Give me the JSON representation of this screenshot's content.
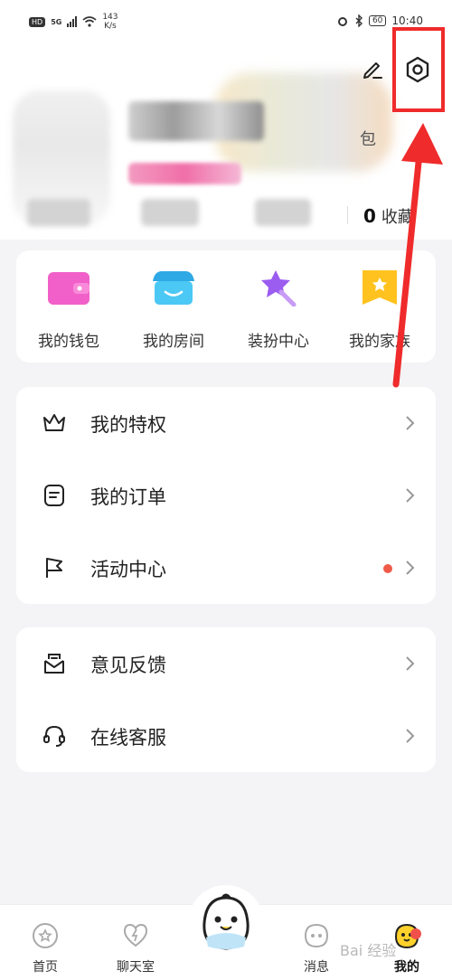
{
  "status_bar": {
    "hd": "HD",
    "network": "5G",
    "speed_value": "143",
    "speed_unit": "K/s",
    "battery": "60",
    "time": "10:40"
  },
  "header": {
    "edit_icon": "edit-icon",
    "settings_icon": "settings-hexagon-icon",
    "banner_suffix": "包",
    "favorites_count": "0",
    "favorites_label": "收藏"
  },
  "quick_actions": [
    {
      "label": "我的钱包",
      "icon": "wallet-icon",
      "color": "#f160c8"
    },
    {
      "label": "我的房间",
      "icon": "store-icon",
      "color": "#4cc8f4"
    },
    {
      "label": "装扮中心",
      "icon": "magic-wand-star-icon",
      "color": "#9b5cf0"
    },
    {
      "label": "我的家族",
      "icon": "family-flag-icon",
      "color": "#ffc21f"
    }
  ],
  "menu_group1": [
    {
      "label": "我的特权",
      "icon": "crown-icon",
      "has_dot": false
    },
    {
      "label": "我的订单",
      "icon": "order-icon",
      "has_dot": false
    },
    {
      "label": "活动中心",
      "icon": "flag-icon",
      "has_dot": true
    }
  ],
  "menu_group2": [
    {
      "label": "意见反馈",
      "icon": "feedback-mail-icon"
    },
    {
      "label": "在线客服",
      "icon": "headset-icon"
    }
  ],
  "tabs": [
    {
      "label": "首页",
      "icon": "home-icon"
    },
    {
      "label": "聊天室",
      "icon": "heart-chat-icon"
    },
    {
      "label": "消息",
      "icon": "message-icon"
    },
    {
      "label": "我的",
      "icon": "profile-mascot-icon"
    }
  ],
  "watermark": "Bai 经验",
  "colors": {
    "highlight_red": "#ef2b2b",
    "notification_dot": "#f05a48",
    "background": "#f4f4f6"
  }
}
